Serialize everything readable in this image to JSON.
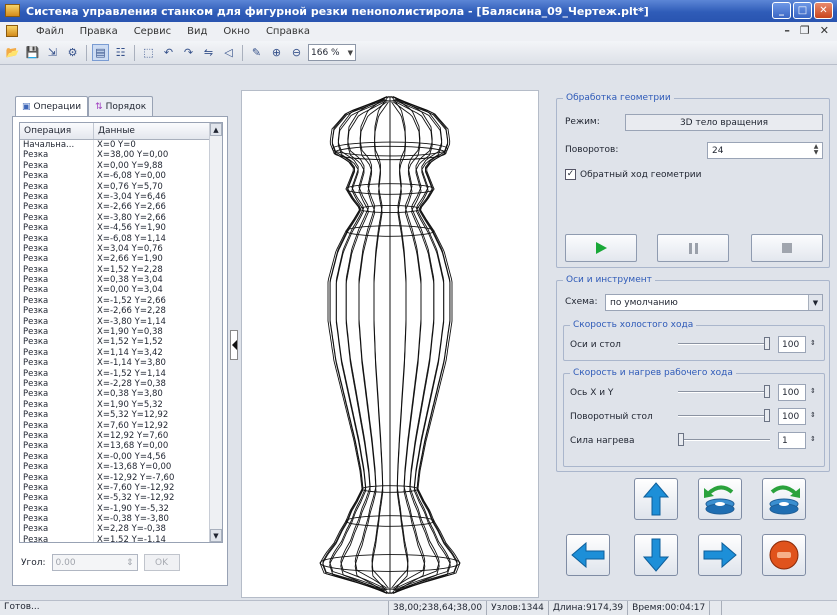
{
  "window": {
    "title": "Система управления станком для фигурной резки пенополистирола - [Балясина_09_Чертеж.plt*]"
  },
  "menu": [
    "Файл",
    "Правка",
    "Сервис",
    "Вид",
    "Окно",
    "Справка"
  ],
  "toolbar": {
    "zoom": "166 %"
  },
  "left_panel": {
    "tabs": [
      "Операции",
      "Порядок"
    ],
    "columns": [
      "Операция",
      "Данные"
    ],
    "rows": [
      [
        "Начальна...",
        "X=0 Y=0"
      ],
      [
        "Резка",
        "X=38,00 Y=0,00"
      ],
      [
        "Резка",
        "X=0,00 Y=9,88"
      ],
      [
        "Резка",
        "X=-6,08 Y=0,00"
      ],
      [
        "Резка",
        "X=0,76 Y=5,70"
      ],
      [
        "Резка",
        "X=-3,04 Y=6,46"
      ],
      [
        "Резка",
        "X=-2,66 Y=2,66"
      ],
      [
        "Резка",
        "X=-3,80 Y=2,66"
      ],
      [
        "Резка",
        "X=-4,56 Y=1,90"
      ],
      [
        "Резка",
        "X=-6,08 Y=1,14"
      ],
      [
        "Резка",
        "X=3,04 Y=0,76"
      ],
      [
        "Резка",
        "X=2,66 Y=1,90"
      ],
      [
        "Резка",
        "X=1,52 Y=2,28"
      ],
      [
        "Резка",
        "X=0,38 Y=3,04"
      ],
      [
        "Резка",
        "X=0,00 Y=3,04"
      ],
      [
        "Резка",
        "X=-1,52 Y=2,66"
      ],
      [
        "Резка",
        "X=-2,66 Y=2,28"
      ],
      [
        "Резка",
        "X=-3,80 Y=1,14"
      ],
      [
        "Резка",
        "X=1,90 Y=0,38"
      ],
      [
        "Резка",
        "X=1,52 Y=1,52"
      ],
      [
        "Резка",
        "X=1,14 Y=3,42"
      ],
      [
        "Резка",
        "X=-1,14 Y=3,80"
      ],
      [
        "Резка",
        "X=-1,52 Y=1,14"
      ],
      [
        "Резка",
        "X=-2,28 Y=0,38"
      ],
      [
        "Резка",
        "X=0,38 Y=3,80"
      ],
      [
        "Резка",
        "X=1,90 Y=5,32"
      ],
      [
        "Резка",
        "X=5,32 Y=12,92"
      ],
      [
        "Резка",
        "X=7,60 Y=12,92"
      ],
      [
        "Резка",
        "X=12,92 Y=7,60"
      ],
      [
        "Резка",
        "X=13,68 Y=0,00"
      ],
      [
        "Резка",
        "X=-0,00 Y=4,56"
      ],
      [
        "Резка",
        "X=-13,68 Y=0,00"
      ],
      [
        "Резка",
        "X=-12,92 Y=-7,60"
      ],
      [
        "Резка",
        "X=-7,60 Y=-12,92"
      ],
      [
        "Резка",
        "X=-5,32 Y=-12,92"
      ],
      [
        "Резка",
        "X=-1,90 Y=-5,32"
      ],
      [
        "Резка",
        "X=-0,38 Y=-3,80"
      ],
      [
        "Резка",
        "X=2,28 Y=-0,38"
      ],
      [
        "Резка",
        "X=1,52 Y=-1,14"
      ]
    ],
    "angle_label": "Угол:",
    "angle_value": "0.00",
    "ok_label": "OK"
  },
  "geometry": {
    "title": "Обработка геометрии",
    "mode_label": "Режим:",
    "mode_value": "3D тело вращения",
    "turns_label": "Поворотов:",
    "turns_value": "24",
    "reverse_label": "Обратный ход геометрии",
    "reverse_checked": true
  },
  "axes": {
    "title": "Оси и инструмент",
    "scheme_label": "Схема:",
    "scheme_value": "по умолчанию",
    "idle_title": "Скорость холостого хода",
    "idle_label": "Оси и стол",
    "idle_value": "100",
    "work_title": "Скорость и нагрев рабочего хода",
    "xy_label": "Ось X и Y",
    "xy_value": "100",
    "rot_label": "Поворотный стол",
    "rot_value": "100",
    "heat_label": "Сила нагрева",
    "heat_value": "1",
    "idle_level": 1.0,
    "xy_level": 1.0,
    "rot_level": 1.0,
    "heat_level": 0.0
  },
  "status": {
    "left": "Готов...",
    "coords": "38,00;238,64;38,00",
    "nodes": "Узлов:1344",
    "length": "Длина:9174,39",
    "time": "Время:00:04:17"
  }
}
